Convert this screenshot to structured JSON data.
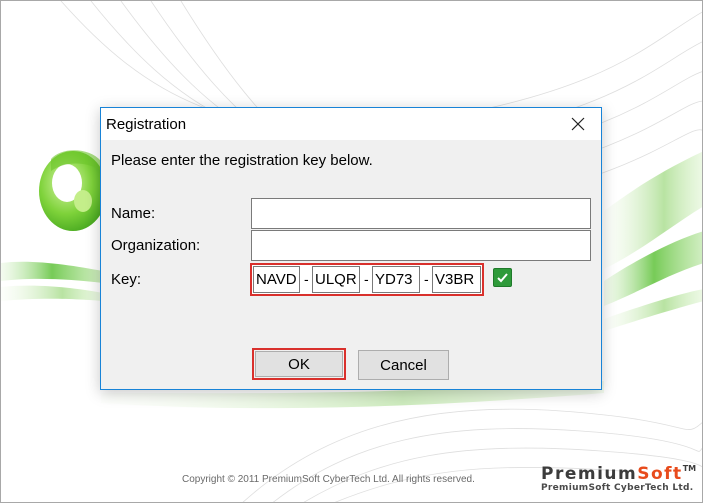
{
  "dialog": {
    "title": "Registration",
    "prompt": "Please enter the registration key below.",
    "name_label": "Name:",
    "name_value": "",
    "organization_label": "Organization:",
    "organization_value": "",
    "key_label": "Key:",
    "key_segments": [
      "NAVD",
      "ULQR",
      "YD73",
      "V3BR"
    ],
    "key_separator": "-",
    "key_valid": true,
    "ok_label": "OK",
    "cancel_label": "Cancel"
  },
  "splash": {
    "copyright": "Copyright © 2011  PremiumSoft CyberTech Ltd. All rights reserved.",
    "brand_prefix": "Premium",
    "brand_accent": "Soft",
    "brand_tm": "TM",
    "brand_sub": "PremiumSoft CyberTech Ltd."
  },
  "colors": {
    "accent_highlight": "#d9302c",
    "dialog_border": "#1883d7",
    "brand_orange": "#e84b1c",
    "check_green": "#2f9a3a"
  },
  "icons": {
    "close": "close-icon",
    "valid": "checkmark-icon",
    "logo": "navicat-logo-icon"
  }
}
